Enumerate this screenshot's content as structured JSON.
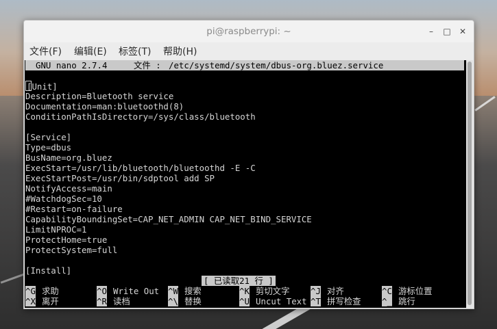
{
  "window": {
    "title": "pi@raspberrypi: ~",
    "buttons": {
      "minimize": "–",
      "maximize": "□",
      "close": "✕"
    }
  },
  "menu": [
    "文件(F)",
    "编辑(E)",
    "标签(T)",
    "帮助(H)"
  ],
  "nano": {
    "version": "GNU nano 2.7.4",
    "file_label": "文件 :",
    "file_path": "/etc/systemd/system/dbus-org.bluez.service",
    "lines": [
      "[Unit]",
      "Description=Bluetooth service",
      "Documentation=man:bluetoothd(8)",
      "ConditionPathIsDirectory=/sys/class/bluetooth",
      "",
      "[Service]",
      "Type=dbus",
      "BusName=org.bluez",
      "ExecStart=/usr/lib/bluetooth/bluetoothd -E -C",
      "ExecStartPost=/usr/bin/sdptool add SP",
      "NotifyAccess=main",
      "#WatchdogSec=10",
      "#Restart=on-failure",
      "CapabilityBoundingSet=CAP_NET_ADMIN CAP_NET_BIND_SERVICE",
      "LimitNPROC=1",
      "ProtectHome=true",
      "ProtectSystem=full",
      "",
      "[Install]"
    ],
    "status_message": "[ 已读取21 行 ]",
    "shortcuts_row1": [
      {
        "key": "^G",
        "label": "求助"
      },
      {
        "key": "^O",
        "label": "Write Out"
      },
      {
        "key": "^W",
        "label": "搜索"
      },
      {
        "key": "^K",
        "label": "剪切文字"
      },
      {
        "key": "^J",
        "label": "对齐"
      },
      {
        "key": "^C",
        "label": "游标位置"
      }
    ],
    "shortcuts_row2": [
      {
        "key": "^X",
        "label": "离开"
      },
      {
        "key": "^R",
        "label": "读档"
      },
      {
        "key": "^\\",
        "label": "替换"
      },
      {
        "key": "^U",
        "label": "Uncut Text"
      },
      {
        "key": "^T",
        "label": "拼写检查"
      },
      {
        "key": "^_",
        "label": "跳行"
      }
    ]
  }
}
